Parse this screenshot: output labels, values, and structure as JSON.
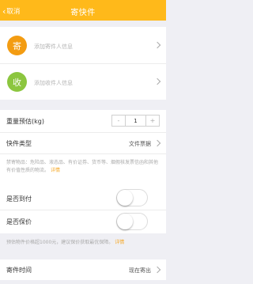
{
  "colors": {
    "brand": "#ffb91a",
    "sender": "#f39c12",
    "receiver": "#8cc63f",
    "link": "#f5a623"
  },
  "navbar": {
    "back_label": "取消",
    "title": "寄快件"
  },
  "sender": {
    "badge": "寄",
    "placeholder": "添加寄件人信息"
  },
  "receiver": {
    "badge": "收",
    "placeholder": "添加收件人信息"
  },
  "weight": {
    "label": "重量预估(kg)",
    "minus": "-",
    "value": "1",
    "plus": "+"
  },
  "item_type": {
    "label": "快件类型",
    "value": "文件票据"
  },
  "prohibited": {
    "text": "禁寄物品：危险品、液态品、有价证券、货币等、烟假核发票信函和其他有价值性质的物流。",
    "link": "详情"
  },
  "cod": {
    "label": "是否到付",
    "on": false
  },
  "insurance": {
    "label": "是否保价",
    "on": false
  },
  "insurance_note": {
    "text": "预估物件价格超1000元，建议保价获取最优保障。",
    "link": "详情"
  },
  "send_time": {
    "label": "寄件时间",
    "value": "现在寄出"
  }
}
